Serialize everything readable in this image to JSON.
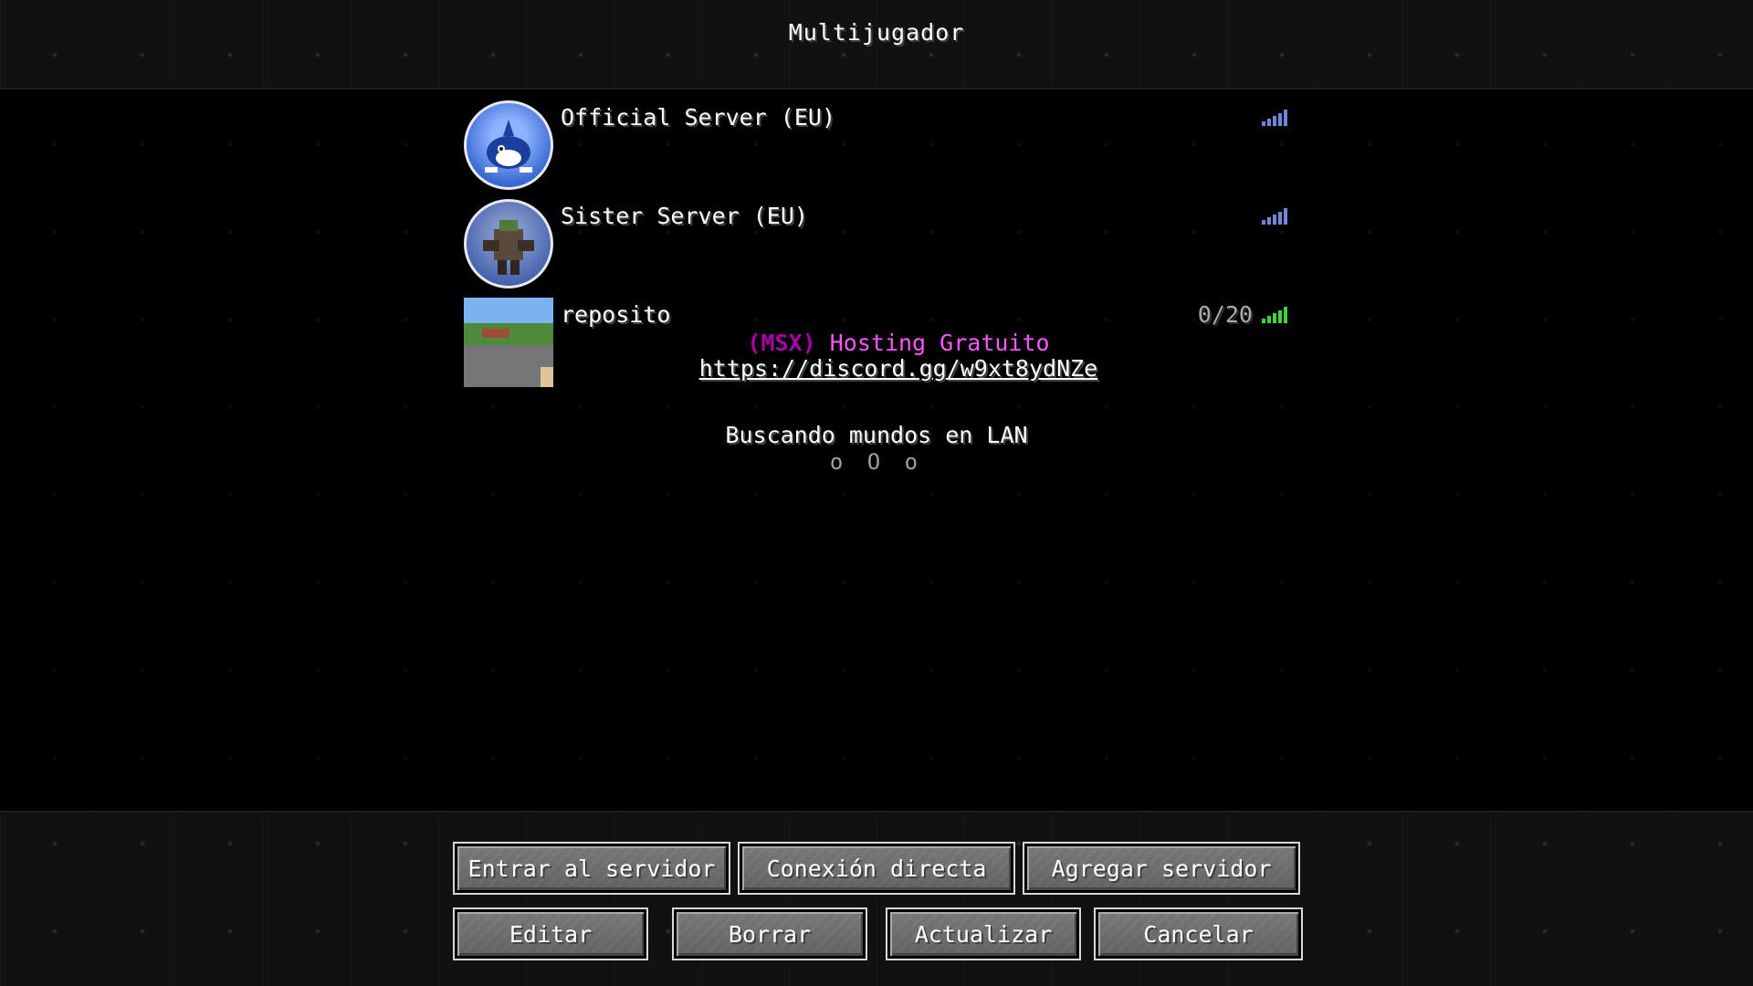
{
  "screen": {
    "title": "Multijugador"
  },
  "servers": [
    {
      "name": "Official Server (EU)",
      "icon": "orca-avatar-icon",
      "signal_color": "#6f86d6",
      "players": "",
      "motd_tag": "",
      "motd_host": "",
      "motd_link": ""
    },
    {
      "name": "Sister Server (EU)",
      "icon": "mech-avatar-icon",
      "signal_color": "#6f86d6",
      "players": "",
      "motd_tag": "",
      "motd_host": "",
      "motd_link": ""
    },
    {
      "name": "reposito",
      "icon": "landscape-thumbnail-icon",
      "signal_color": "#3fd13f",
      "players": "0/20",
      "motd_tag": "(MSX)",
      "motd_host": "Hosting Gratuito",
      "motd_link": "https://discord.gg/w9xt8ydNZe"
    }
  ],
  "lan": {
    "text": "Buscando mundos en LAN",
    "dots": "o O o"
  },
  "buttons": {
    "join": "Entrar al servidor",
    "direct": "Conexión directa",
    "add": "Agregar servidor",
    "edit": "Editar",
    "delete": "Borrar",
    "refresh": "Actualizar",
    "cancel": "Cancelar"
  },
  "colors": {
    "motd_tag": "#aa00aa",
    "motd_host": "#ff55ff",
    "players": "#aaaaaa"
  }
}
